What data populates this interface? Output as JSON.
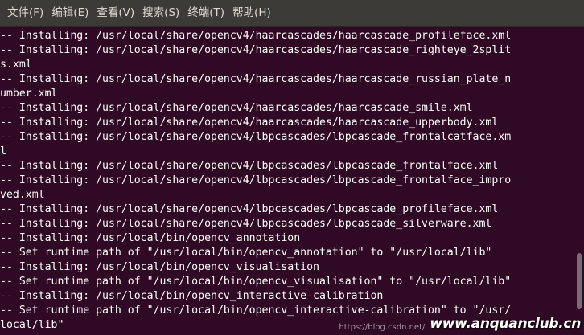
{
  "menubar": {
    "items": [
      {
        "label": "文件(F)"
      },
      {
        "label": "编辑(E)"
      },
      {
        "label": "查看(V)"
      },
      {
        "label": "搜索(S)"
      },
      {
        "label": "终端(T)"
      },
      {
        "label": "帮助(H)"
      }
    ]
  },
  "terminal": {
    "lines": [
      "-- Installing: /usr/local/share/opencv4/haarcascades/haarcascade_profileface.xml",
      "-- Installing: /usr/local/share/opencv4/haarcascades/haarcascade_righteye_2split",
      "s.xml",
      "-- Installing: /usr/local/share/opencv4/haarcascades/haarcascade_russian_plate_n",
      "umber.xml",
      "-- Installing: /usr/local/share/opencv4/haarcascades/haarcascade_smile.xml",
      "-- Installing: /usr/local/share/opencv4/haarcascades/haarcascade_upperbody.xml",
      "-- Installing: /usr/local/share/opencv4/lbpcascades/lbpcascade_frontalcatface.xm",
      "l",
      "-- Installing: /usr/local/share/opencv4/lbpcascades/lbpcascade_frontalface.xml",
      "-- Installing: /usr/local/share/opencv4/lbpcascades/lbpcascade_frontalface_impro",
      "ved.xml",
      "-- Installing: /usr/local/share/opencv4/lbpcascades/lbpcascade_profileface.xml",
      "-- Installing: /usr/local/share/opencv4/lbpcascades/lbpcascade_silverware.xml",
      "-- Installing: /usr/local/bin/opencv_annotation",
      "-- Set runtime path of \"/usr/local/bin/opencv_annotation\" to \"/usr/local/lib\"",
      "-- Installing: /usr/local/bin/opencv_visualisation",
      "-- Set runtime path of \"/usr/local/bin/opencv_visualisation\" to \"/usr/local/lib\"",
      "-- Installing: /usr/local/bin/opencv_interactive-calibration",
      "-- Set runtime path of \"/usr/local/bin/opencv_interactive-calibration\" to \"/usr/",
      "local/lib\""
    ]
  },
  "watermark": {
    "url": "https://blog.csdn.net/",
    "logo": "www.anquanclub.cn"
  },
  "colors": {
    "background": "#300a24",
    "menubar": "#3c3b37",
    "text": "#ffffff"
  }
}
